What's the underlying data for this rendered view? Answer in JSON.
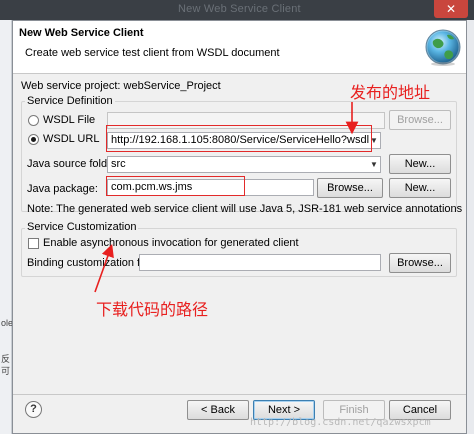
{
  "background": {
    "ghost_title": "New Web Service Client"
  },
  "left_sliver": [
    "ole",
    "反",
    "可"
  ],
  "dialog": {
    "title": "New Web Service Client",
    "description": "Create web service test client from WSDL document",
    "project_label": "Web service project: webService_Project",
    "service_definition": {
      "group_label": "Service Definition",
      "wsdl_file_label": "WSDL File",
      "wsdl_file_value": "",
      "wsdl_url_label": "WSDL URL",
      "wsdl_url_value": "http://192.168.1.105:8080/Service/ServiceHello?wsdl",
      "browse_disabled_label": "Browse...",
      "source_folder_label": "Java source folder:",
      "source_folder_value": "src",
      "new_label_1": "New...",
      "package_label": "Java package:",
      "package_value": "com.pcm.ws.jms",
      "browse_label": "Browse...",
      "new_label_2": "New...",
      "note": "Note: The generated web service client will use Java 5, JSR-181 web service annotations"
    },
    "customization": {
      "group_label": "Service Customization",
      "async_label": "Enable asynchronous invocation for generated client",
      "binding_label": "Binding customization file:",
      "binding_value": "",
      "browse_label": "Browse..."
    },
    "footer": {
      "help_symbol": "?",
      "back_label": "< Back",
      "next_label": "Next >",
      "finish_label": "Finish",
      "cancel_label": "Cancel"
    }
  },
  "annotations": {
    "publish_address": "发布的地址",
    "download_path": "下载代码的路径"
  },
  "watermark": "http://blog.csdn.net/qazwsxpcm",
  "colors": {
    "annotation": "#e8201f",
    "close_button": "#c9463d"
  }
}
